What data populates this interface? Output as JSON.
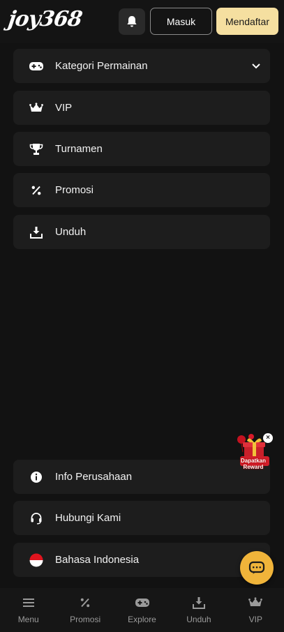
{
  "header": {
    "logo_text": "joy368",
    "login_label": "Masuk",
    "register_label": "Mendaftar"
  },
  "menu": {
    "items": [
      {
        "label": "Kategori Permainan",
        "icon": "gamepad-icon"
      },
      {
        "label": "VIP",
        "icon": "crown-icon"
      },
      {
        "label": "Turnamen",
        "icon": "trophy-icon"
      },
      {
        "label": "Promosi",
        "icon": "percent-icon"
      },
      {
        "label": "Unduh",
        "icon": "download-icon"
      }
    ]
  },
  "footer_menu": {
    "items": [
      {
        "label": "Info Perusahaan",
        "icon": "info-icon"
      },
      {
        "label": "Hubungi Kami",
        "icon": "headset-icon"
      },
      {
        "label": "Bahasa Indonesia",
        "icon": "indonesia-flag-icon"
      }
    ]
  },
  "reward": {
    "label": "Dapatkan Reward",
    "close": "×"
  },
  "bottom_nav": {
    "items": [
      {
        "label": "Menu",
        "icon": "menu-icon"
      },
      {
        "label": "Promosi",
        "icon": "percent-icon"
      },
      {
        "label": "Explore",
        "icon": "gamepad-icon"
      },
      {
        "label": "Unduh",
        "icon": "download-icon"
      },
      {
        "label": "VIP",
        "icon": "crown-icon"
      }
    ]
  },
  "colors": {
    "background": "#121212",
    "card": "#1d1d1d",
    "accent_gold": "#f5dfa0",
    "chat_button": "#f0b43a"
  }
}
